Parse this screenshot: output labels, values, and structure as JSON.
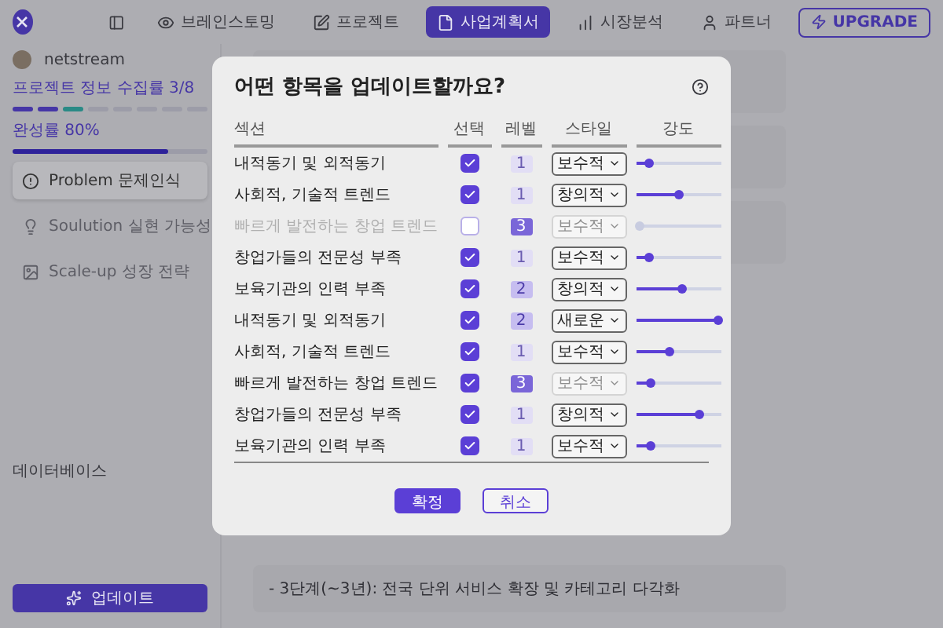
{
  "sidebar": {
    "user": "netstream",
    "collect_label": "프로젝트 정보 수집률 3/8",
    "segments": [
      {
        "color": "#4636a6"
      },
      {
        "color": "#4636a6"
      },
      {
        "color": "#2a8a86"
      },
      {
        "color": "#9c9ca8"
      },
      {
        "color": "#9c9ca8"
      },
      {
        "color": "#9c9ca8"
      },
      {
        "color": "#9c9ca8"
      },
      {
        "color": "#9c9ca8"
      }
    ],
    "completion": {
      "label": "완성률 80%",
      "level": 0.8
    },
    "items": [
      {
        "label": "Problem 문제인식",
        "kind": "alert",
        "selected": true
      },
      {
        "label": "Soulution 실현 가능성",
        "kind": "bulb",
        "selected": false
      },
      {
        "label": "Scale-up 성장 전략",
        "kind": "chart",
        "selected": false
      }
    ],
    "section_title": "데이터베이스",
    "update_button": "업데이트"
  },
  "tabs": [
    {
      "label": "브레인스토밍",
      "kind": "eye",
      "selected": false
    },
    {
      "label": "프로젝트",
      "kind": "pen",
      "selected": false
    },
    {
      "label": "사업계획서",
      "kind": "doc",
      "selected": true
    },
    {
      "label": "시장분석",
      "kind": "bars",
      "selected": false
    },
    {
      "label": "파트너",
      "kind": "person",
      "selected": false
    }
  ],
  "upgrade_button": "UPGRADE",
  "background_text": "- 3단계(~3년): 전국 단위 서비스 확장 및 카테고리 다각화",
  "dialog": {
    "title": "어떤 항목을 업데이트할까요?",
    "columns": [
      "섹션",
      "선택",
      "레벨",
      "스타일",
      "강도"
    ],
    "rows": [
      {
        "section": "내적동기 및 외적동기",
        "disabled": false,
        "checked": true,
        "level_badge": {
          "text": "1",
          "kind": "light"
        },
        "style": "보수적",
        "style_disabled": false,
        "level": 0.15
      },
      {
        "section": "사회적, 기술적 트렌드",
        "disabled": false,
        "checked": true,
        "level_badge": {
          "text": "1",
          "kind": "light"
        },
        "style": "창의적",
        "style_disabled": false,
        "level": 0.5
      },
      {
        "section": "빠르게 발전하는 창업 트렌드",
        "disabled": true,
        "checked": false,
        "level_badge": {
          "text": "3",
          "kind": "strong"
        },
        "style": "보수적",
        "style_disabled": true,
        "level": 0.04
      },
      {
        "section": "창업가들의 전문성 부족",
        "disabled": false,
        "checked": true,
        "level_badge": {
          "text": "1",
          "kind": "light"
        },
        "style": "보수적",
        "style_disabled": false,
        "level": 0.15
      },
      {
        "section": "보육기관의 인력 부족",
        "disabled": false,
        "checked": true,
        "level_badge": {
          "text": "2",
          "kind": "medium"
        },
        "style": "창의적",
        "style_disabled": false,
        "level": 0.55
      },
      {
        "section": "내적동기 및 외적동기",
        "disabled": false,
        "checked": true,
        "level_badge": {
          "text": "2",
          "kind": "medium"
        },
        "style": "새로운",
        "style_disabled": false,
        "level": 0.97
      },
      {
        "section": "사회적, 기술적 트렌드",
        "disabled": false,
        "checked": true,
        "level_badge": {
          "text": "1",
          "kind": "light"
        },
        "style": "보수적",
        "style_disabled": false,
        "level": 0.4
      },
      {
        "section": "빠르게 발전하는 창업 트렌드",
        "disabled": false,
        "checked": true,
        "level_badge": {
          "text": "3",
          "kind": "strong"
        },
        "style": "보수적",
        "style_disabled": true,
        "level": 0.17
      },
      {
        "section": "창업가들의 전문성 부족",
        "disabled": false,
        "checked": true,
        "level_badge": {
          "text": "1",
          "kind": "light"
        },
        "style": "창의적",
        "style_disabled": false,
        "level": 0.75
      },
      {
        "section": "보육기관의 인력 부족",
        "disabled": false,
        "checked": true,
        "level_badge": {
          "text": "1",
          "kind": "light"
        },
        "style": "보수적",
        "style_disabled": false,
        "level": 0.17
      }
    ],
    "confirm_button": "확정",
    "cancel_button": "취소"
  }
}
